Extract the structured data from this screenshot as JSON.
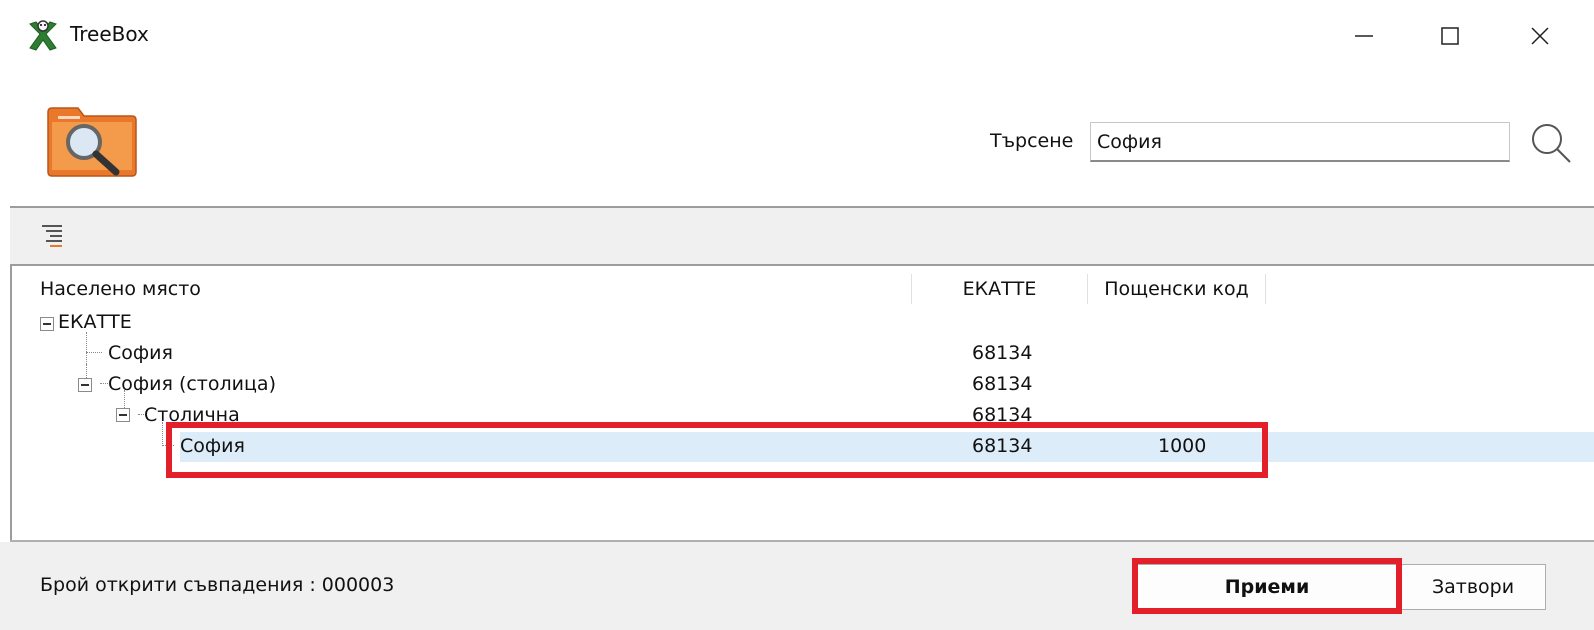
{
  "window": {
    "title": "TreeBox",
    "controls": {
      "minimize": "—",
      "maximize": "☐",
      "close": "✕"
    }
  },
  "search": {
    "label": "Търсене",
    "value": "София",
    "icon": "search-icon"
  },
  "grid": {
    "columns": [
      "Населено място",
      "ЕКАТТЕ",
      "Пощенски код"
    ],
    "rows": [
      {
        "name": "ЕКАТТЕ",
        "ekatte": "",
        "postal": ""
      },
      {
        "name": "София",
        "ekatte": "68134",
        "postal": ""
      },
      {
        "name": "София (столица)",
        "ekatte": "68134",
        "postal": ""
      },
      {
        "name": "Столична",
        "ekatte": "68134",
        "postal": ""
      },
      {
        "name": "София",
        "ekatte": "68134",
        "postal": "1000"
      }
    ]
  },
  "footer": {
    "status": "Брой открити съвпадения : 000003",
    "accept_label": "Приеми",
    "close_label": "Затвори"
  },
  "colors": {
    "highlight": "#e3202a",
    "selection": "#dcecf8"
  }
}
